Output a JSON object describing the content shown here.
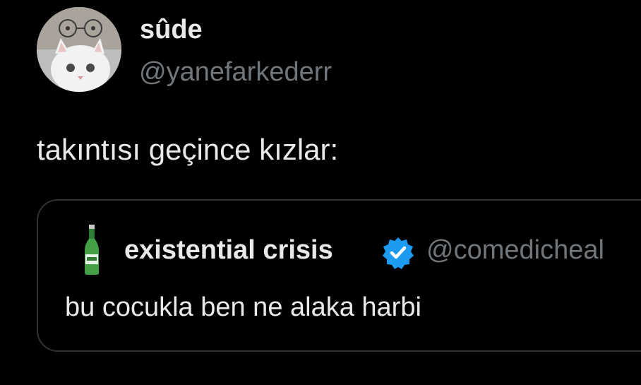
{
  "tweet": {
    "author": {
      "display_name": "sûde",
      "handle": "@yanefarkederr",
      "avatar": "cat-selfie-avatar"
    },
    "text": "takıntısı geçince kızlar:",
    "quoted_tweet": {
      "author": {
        "display_name": "existential crisis",
        "handle": "@comedicheal",
        "avatar": "green-bottle-avatar",
        "verified": true,
        "verified_icon": "verified-badge-icon"
      },
      "text": "bu cocukla ben ne alaka harbi"
    }
  },
  "colors": {
    "background": "#000000",
    "primary_text": "#e7e9ea",
    "secondary_text": "#71767b",
    "border": "#2f3336",
    "verified_blue": "#1d9bf0"
  }
}
